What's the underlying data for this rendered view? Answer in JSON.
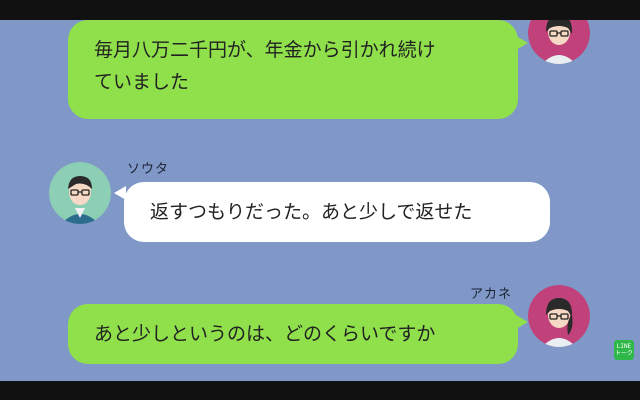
{
  "messages": [
    {
      "side": "right",
      "sender": "",
      "text_line1": "毎月八万二千円が、年金から引かれ続け",
      "text_line2": "ていました"
    },
    {
      "side": "left",
      "sender": "ソウタ",
      "text": "返すつもりだった。あと少しで返せた"
    },
    {
      "side": "right",
      "sender": "アカネ",
      "text": "あと少しというのは、どのくらいですか"
    }
  ],
  "logo": {
    "text": "LINE トーク"
  },
  "colors": {
    "chat_bg": "#7f98c8",
    "sent_bubble": "#8fe04a",
    "received_bubble": "#ffffff",
    "bars": "#111111"
  },
  "avatars": {
    "akane": "woman-avatar-icon",
    "souta": "man-avatar-icon"
  }
}
